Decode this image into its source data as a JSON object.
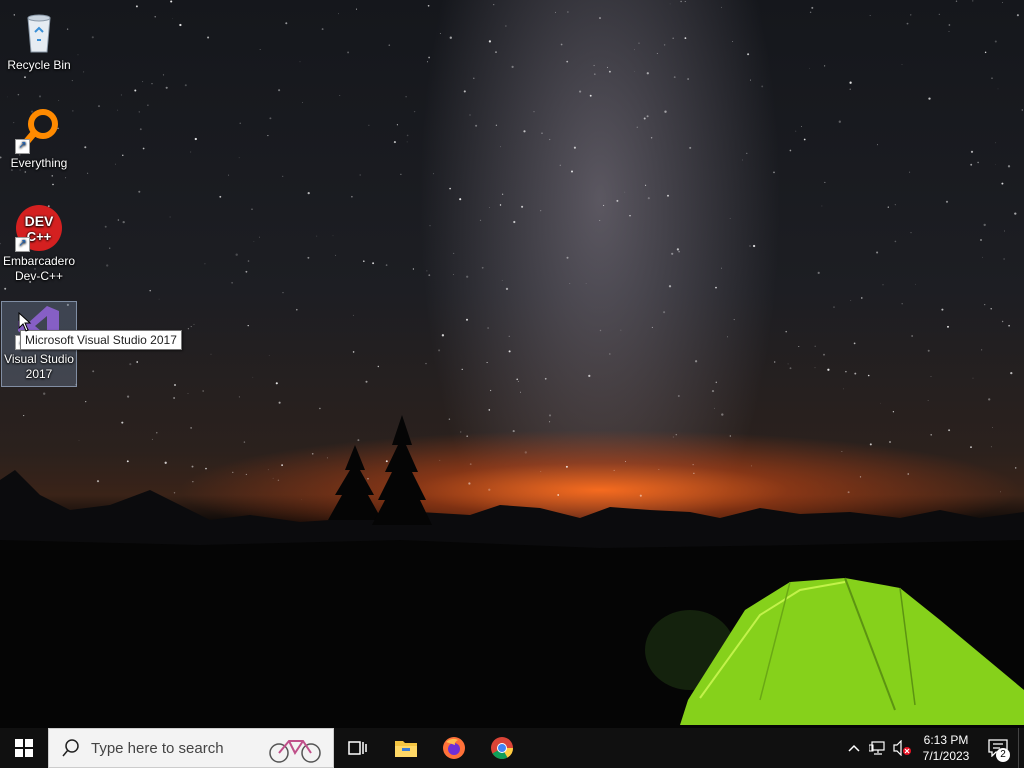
{
  "desktop": {
    "icons": [
      {
        "label": "Recycle Bin",
        "icon": "recycle-bin-icon",
        "shortcut": false
      },
      {
        "label": "Everything",
        "icon": "everything-search-icon",
        "shortcut": true
      },
      {
        "label": "Embarcadero Dev-C++",
        "icon": "devcpp-icon",
        "shortcut": true,
        "icon_text_top": "DEV",
        "icon_text_bottom": "C++"
      },
      {
        "label": "Visual Studio 2017",
        "icon": "visual-studio-icon",
        "shortcut": true,
        "selected": true
      }
    ],
    "tooltip": "Microsoft Visual Studio 2017"
  },
  "taskbar": {
    "search_placeholder": "Type here to search",
    "pinned": [
      "task-view-icon",
      "file-explorer-icon",
      "firefox-icon",
      "chrome-icon"
    ],
    "tray": {
      "time": "6:13 PM",
      "date": "7/1/2023",
      "notification_count": "2",
      "volume_muted": true
    }
  },
  "colors": {
    "taskbar": "#101010",
    "tent_green": "#8fe01e",
    "horizon_glow": "#ff6e1e"
  }
}
